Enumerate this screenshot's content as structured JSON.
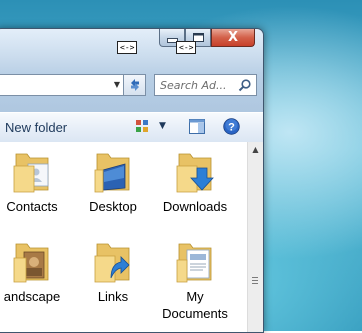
{
  "window": {
    "caption_buttons": {
      "minimize": "minimize",
      "maximize": "maximize",
      "close": "X"
    },
    "resize_indicator": "<->",
    "search": {
      "placeholder": "Search Ad..."
    },
    "toolbar": {
      "new_folder_label": "New folder"
    },
    "items": [
      {
        "label": "Contacts",
        "icon": "contacts-folder-icon"
      },
      {
        "label": "Desktop",
        "icon": "desktop-folder-icon"
      },
      {
        "label": "Downloads",
        "icon": "downloads-folder-icon"
      },
      {
        "label": "andscape",
        "icon": "landscape-folder-icon"
      },
      {
        "label": "Links",
        "icon": "links-folder-icon"
      },
      {
        "label": "My\nDocuments",
        "icon": "documents-folder-icon"
      }
    ]
  },
  "colors": {
    "toolbar_text": "#1e395b",
    "close_button": "#c7402a",
    "help_icon": "#2a64c4",
    "desktop_background": "#3aa3c5"
  }
}
